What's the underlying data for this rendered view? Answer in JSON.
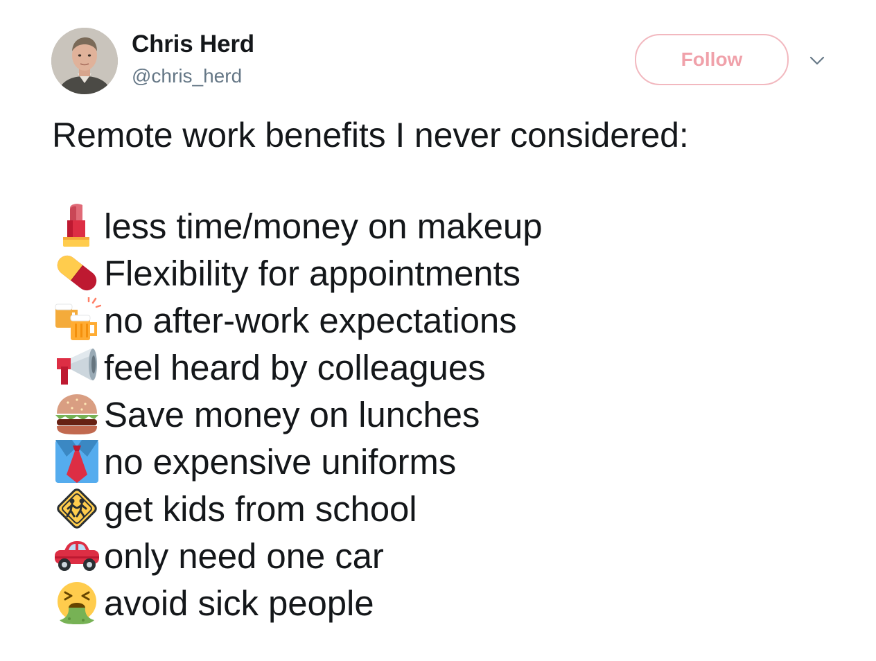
{
  "author": {
    "display_name": "Chris Herd",
    "handle": "@chris_herd"
  },
  "actions": {
    "follow_label": "Follow",
    "menu_icon": "chevron-down-icon"
  },
  "tweet": {
    "heading": "Remote work benefits I never considered:",
    "items": [
      {
        "emoji": "lipstick-icon",
        "text": "less time/money on makeup"
      },
      {
        "emoji": "pill-icon",
        "text": "Flexibility for appointments"
      },
      {
        "emoji": "clinking-beer-mugs-icon",
        "text": "no after-work expectations"
      },
      {
        "emoji": "megaphone-icon",
        "text": "feel heard by colleagues"
      },
      {
        "emoji": "hamburger-icon",
        "text": "Save money on lunches"
      },
      {
        "emoji": "necktie-icon",
        "text": "no expensive uniforms"
      },
      {
        "emoji": "children-crossing-icon",
        "text": "get kids from school"
      },
      {
        "emoji": "car-icon",
        "text": "only need one car"
      },
      {
        "emoji": "vomiting-face-icon",
        "text": "avoid sick people"
      }
    ]
  },
  "colors": {
    "follow_border": "#f2b8bf",
    "follow_text": "#f0a1aa",
    "handle": "#657786",
    "text": "#14171a"
  }
}
